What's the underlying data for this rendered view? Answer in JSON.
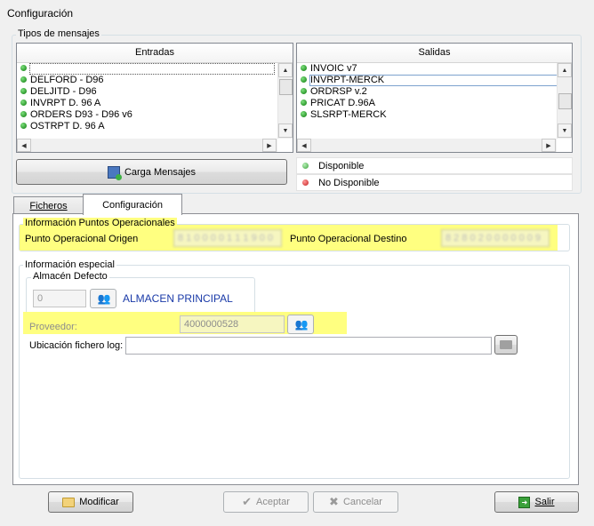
{
  "window": {
    "title": "Configuración"
  },
  "tipos": {
    "legend": "Tipos de mensajes",
    "entradas": {
      "header": "Entradas",
      "items": [
        "",
        "DELFORD - D96",
        "DELJITD - D96",
        "INVRPT D. 96 A",
        "ORDERS D93 - D96 v6",
        "OSTRPT D. 96 A"
      ]
    },
    "salidas": {
      "header": "Salidas",
      "items": [
        "INVOIC v7",
        "INVRPT-MERCK",
        "ORDRSP v.2",
        "PRICAT D.96A",
        "SLSRPT-MERCK"
      ]
    },
    "carga_button": "Carga Mensajes",
    "legend_disponible": "Disponible",
    "legend_no_disponible": "No Disponible"
  },
  "tabs": {
    "ficheros": "Ficheros",
    "configuracion": "Configuración"
  },
  "puntos": {
    "legend": "Información Puntos Operacionales",
    "origen_label": "Punto Operacional Origen",
    "destino_label": "Punto Operacional Destino"
  },
  "especial": {
    "legend": "Información especial",
    "almacen_legend": "Almacén Defecto",
    "almacen_value": "0",
    "almacen_name": "ALMACEN PRINCIPAL",
    "proveedor_label": "Proveedor:",
    "proveedor_value": "4000000528",
    "log_label": "Ubicación fichero log:",
    "log_value": ""
  },
  "buttons": {
    "modificar": "Modificar",
    "aceptar": "Aceptar",
    "cancelar": "Cancelar",
    "salir": "Salir"
  },
  "colors": {
    "highlight": "#ffff80",
    "link_blue": "#1a3aa8",
    "available": "#0a7a0a",
    "unavailable": "#c41e1e"
  }
}
